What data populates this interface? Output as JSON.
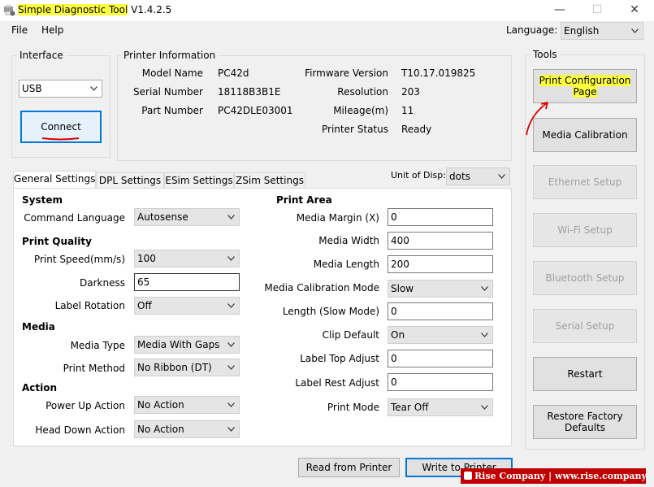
{
  "window": {
    "title_highlighted": "Simple Diagnostic Tool",
    "title_version": " V1.4.2.5",
    "minimize": "—",
    "maximize": "☐",
    "close": "✕"
  },
  "menu": {
    "file": "File",
    "help": "Help"
  },
  "language": {
    "label": "Language:",
    "value": "English"
  },
  "interface": {
    "title": "Interface",
    "value": "USB",
    "connect": "Connect"
  },
  "printer_info": {
    "title": "Printer Information",
    "model_name_label": "Model Name",
    "model_name": "PC42d",
    "serial_label": "Serial Number",
    "serial": "18118B3B1E",
    "part_label": "Part Number",
    "part": "PC42DLE03001",
    "firmware_label": "Firmware Version",
    "firmware": "T10.17.019825",
    "resolution_label": "Resolution",
    "resolution": "203",
    "mileage_label": "Mileage(m)",
    "mileage": "11",
    "status_label": "Printer Status",
    "status": "Ready"
  },
  "tabs": [
    "General Settings",
    "DPL Settings",
    "ESim Settings",
    "ZSim Settings"
  ],
  "unit": {
    "label": "Unit of Disp:",
    "value": "dots"
  },
  "settings": {
    "system_header": "System",
    "command_language_label": "Command Language",
    "command_language": "Autosense",
    "quality_header": "Print Quality",
    "print_speed_label": "Print Speed(mm/s)",
    "print_speed": "100",
    "darkness_label": "Darkness",
    "darkness": "65",
    "label_rotation_label": "Label Rotation",
    "label_rotation": "Off",
    "media_header": "Media",
    "media_type_label": "Media Type",
    "media_type": "Media With Gaps",
    "print_method_label": "Print Method",
    "print_method": "No Ribbon (DT)",
    "action_header": "Action",
    "power_up_label": "Power Up Action",
    "power_up": "No Action",
    "head_down_label": "Head Down Action",
    "head_down": "No Action",
    "print_area_header": "Print Area",
    "media_margin_label": "Media Margin (X)",
    "media_margin": "0",
    "media_width_label": "Media Width",
    "media_width": "400",
    "media_length_label": "Media Length",
    "media_length": "200",
    "calib_mode_label": "Media Calibration Mode",
    "calib_mode": "Slow",
    "length_slow_label": "Length (Slow Mode)",
    "length_slow": "0",
    "clip_default_label": "Clip Default",
    "clip_default": "On",
    "label_top_label": "Label Top Adjust",
    "label_top": "0",
    "label_rest_label": "Label Rest Adjust",
    "label_rest": "0",
    "print_mode_label": "Print Mode",
    "print_mode": "Tear Off"
  },
  "tools": {
    "title": "Tools",
    "print_config_line1": "Print Configuration",
    "print_config_line2": "Page",
    "media_calibration": "Media Calibration",
    "ethernet_setup": "Ethernet Setup",
    "wifi_setup": "Wi-Fi Setup",
    "bluetooth_setup": "Bluetooth Setup",
    "serial_setup": "Serial Setup",
    "restart": "Restart",
    "restore_line1": "Restore Factory",
    "restore_line2": "Defaults"
  },
  "bottom": {
    "read": "Read from Printer",
    "write": "Write to Printer"
  },
  "watermark": "Rise Company | www.rise.company",
  "colors": {
    "highlight": "#ffff3d",
    "annotation_red": "#e00000",
    "accent_blue": "#0078d7"
  }
}
